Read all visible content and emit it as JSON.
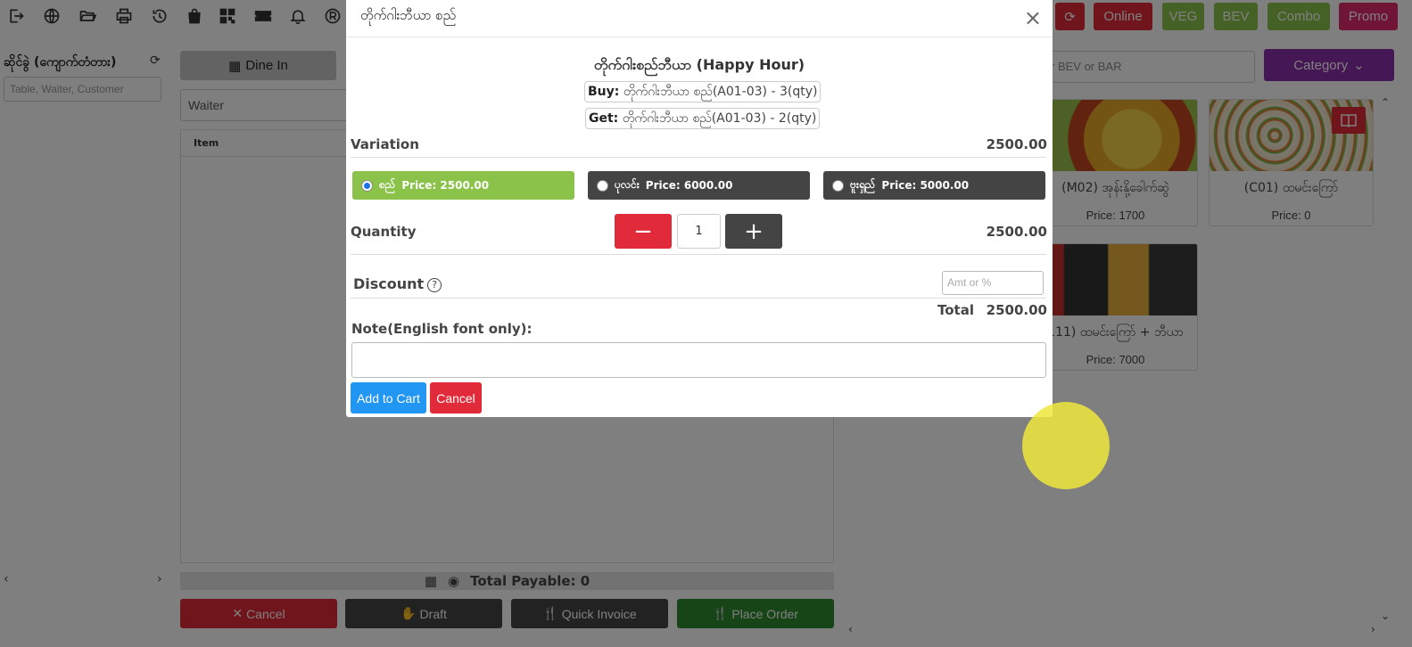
{
  "toolbar": {
    "icons": [
      "logout-icon",
      "globe-icon",
      "folder-open-icon",
      "printer-icon",
      "history-icon",
      "shopping-bag-icon",
      "qrcode-icon",
      "ticket-icon",
      "bell-icon",
      "registered-icon"
    ],
    "category_buttons": [
      {
        "label": "Online",
        "color": "#e22b3a"
      },
      {
        "label": "VEG",
        "color": "#8bc34a"
      },
      {
        "label": "BEV",
        "color": "#8bc34a"
      },
      {
        "label": "Combo",
        "color": "#8bc34a"
      },
      {
        "label": "Promo",
        "color": "#e02a6a"
      }
    ],
    "refresh_color": "#e22b3a"
  },
  "left_panel": {
    "title": "ဆိုင်ခွဲ (ကျောက်တံတား)",
    "search_placeholder": "Table, Waiter, Customer"
  },
  "order": {
    "dine_in_label": "Dine In",
    "waiter_label": "Waiter",
    "item_header": "Item",
    "total_payable": "Total Payable: 0",
    "buttons": {
      "cancel": "Cancel",
      "draft": "Draft",
      "quick_invoice": "Quick Invoice",
      "place_order": "Place Order"
    }
  },
  "menu": {
    "search_placeholder": "r BEV or BAR",
    "category_label": "Category",
    "items": [
      {
        "name": "(M02) အုန်းနို့ခေါက်ဆွဲ",
        "price": "Price: 1700"
      },
      {
        "name": "(C01) ထမင်းကြော်",
        "price": "Price: 0"
      },
      {
        "name": "111) ထမင်းကြော် + ဘီယာ",
        "price": "Price: 7000"
      }
    ]
  },
  "modal": {
    "title": "တိုက်ဂါးဘီယာ စည်",
    "heading": "တိုက်ဂါးစည်ဘီယာ (Happy Hour)",
    "buy_label": "Buy:",
    "buy_text": "တိုက်ဂါးဘီယာ စည်(A01-03) - 3(qty)",
    "get_label": "Get:",
    "get_text": "တိုက်ဂါးဘီယာ စည်(A01-03) - 2(qty)",
    "variation_label": "Variation",
    "variation_value": "2500.00",
    "variations": [
      {
        "name": "စည်",
        "price": "Price: 2500.00",
        "selected": true,
        "color": "#8bc34a"
      },
      {
        "name": "ပုလင်း",
        "price": "Price: 6000.00",
        "selected": false,
        "color": "#444444"
      },
      {
        "name": "ဗူးရှည်",
        "price": "Price: 5000.00",
        "selected": false,
        "color": "#444444"
      }
    ],
    "quantity_label": "Quantity",
    "quantity": "1",
    "quantity_value": "2500.00",
    "discount_label": "Discount",
    "discount_placeholder": "Amt or %",
    "total_label": "Total",
    "total_value": "2500.00",
    "note_label": "Note(English font only):",
    "add_to_cart": "Add to Cart",
    "cancel": "Cancel"
  }
}
